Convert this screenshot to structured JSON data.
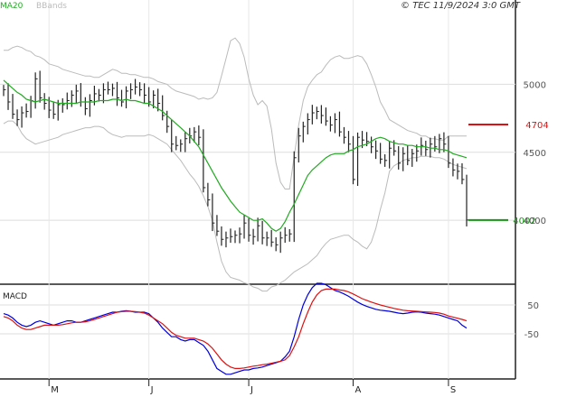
{
  "header": {
    "indicator_ma": "MA20",
    "indicator_bb": "BBands",
    "copyright": "© TEC 11/9/2024 3:0 GMT"
  },
  "macd_title": "MACD",
  "colors": {
    "price": "#222222",
    "ma": "#22aa22",
    "bbands": "#bbbbbb",
    "macd": "#0000dd",
    "signal": "#dd1111",
    "resistance": "#dd1111",
    "support": "#119911",
    "grid": "#dddddd"
  },
  "chart_data": [
    {
      "type": "bar",
      "subtype": "ohlc_price_chart",
      "y_ticks": [
        "5000",
        "4500",
        "4000"
      ],
      "y_tick_values": [
        5000,
        4500,
        4000
      ],
      "ylim": [
        3550,
        5500
      ],
      "x_ticks": [
        {
          "label": "M",
          "index": 10
        },
        {
          "label": "J",
          "index": 32
        },
        {
          "label": "J",
          "index": 54
        },
        {
          "label": "A",
          "index": 77
        },
        {
          "label": "S",
          "index": 98
        }
      ],
      "levels": [
        {
          "name": "resistance",
          "value": 4704,
          "label": "4704"
        },
        {
          "name": "support",
          "value": 4002,
          "label": "4002"
        }
      ],
      "close": [
        4960,
        4870,
        4780,
        4740,
        4790,
        4800,
        4880,
        5040,
        4900,
        4860,
        4810,
        4780,
        4850,
        4850,
        4880,
        4920,
        4950,
        4870,
        4820,
        4880,
        4930,
        4920,
        4960,
        4960,
        4970,
        4900,
        4870,
        4950,
        4960,
        4980,
        4960,
        4920,
        4870,
        4920,
        4860,
        4770,
        4690,
        4560,
        4550,
        4560,
        4600,
        4620,
        4650,
        4610,
        4240,
        4150,
        3980,
        3920,
        3860,
        3870,
        3880,
        3890,
        3900,
        3980,
        3890,
        3880,
        3960,
        3870,
        3870,
        3840,
        3820,
        3870,
        3890,
        3900,
        4460,
        4620,
        4690,
        4740,
        4790,
        4800,
        4770,
        4730,
        4700,
        4740,
        4650,
        4610,
        4560,
        4300,
        4610,
        4590,
        4580,
        4540,
        4510,
        4450,
        4440,
        4530,
        4510,
        4420,
        4490,
        4440,
        4490,
        4510,
        4550,
        4520,
        4560,
        4540,
        4600,
        4560,
        4420,
        4370,
        4360,
        4300,
        4002
      ],
      "ma20": [
        5030,
        5000,
        4970,
        4940,
        4920,
        4890,
        4880,
        4870,
        4880,
        4890,
        4880,
        4870,
        4860,
        4860,
        4860,
        4860,
        4860,
        4870,
        4870,
        4870,
        4870,
        4880,
        4880,
        4880,
        4890,
        4890,
        4880,
        4890,
        4880,
        4880,
        4870,
        4860,
        4860,
        4840,
        4820,
        4800,
        4770,
        4740,
        4710,
        4680,
        4650,
        4620,
        4580,
        4540,
        4480,
        4420,
        4360,
        4300,
        4240,
        4190,
        4140,
        4100,
        4060,
        4040,
        4020,
        4000,
        4000,
        4010,
        3980,
        3940,
        3920,
        3940,
        3990,
        4060,
        4120,
        4190,
        4260,
        4330,
        4370,
        4400,
        4430,
        4460,
        4480,
        4490,
        4490,
        4490,
        4510,
        4520,
        4540,
        4550,
        4560,
        4580,
        4600,
        4610,
        4600,
        4580,
        4570,
        4560,
        4560,
        4550,
        4550,
        4540,
        4540,
        4540,
        4530,
        4530,
        4520,
        4520,
        4510,
        4490,
        4480,
        4470,
        4460
      ],
      "bb_upper": [
        5250,
        5250,
        5270,
        5280,
        5270,
        5250,
        5240,
        5210,
        5200,
        5180,
        5150,
        5140,
        5130,
        5110,
        5100,
        5090,
        5080,
        5070,
        5060,
        5060,
        5050,
        5050,
        5070,
        5090,
        5110,
        5100,
        5080,
        5080,
        5070,
        5070,
        5060,
        5050,
        5050,
        5040,
        5020,
        5010,
        5000,
        4970,
        4950,
        4940,
        4930,
        4920,
        4910,
        4890,
        4900,
        4890,
        4900,
        4940,
        5060,
        5190,
        5320,
        5340,
        5300,
        5200,
        5040,
        4920,
        4850,
        4880,
        4840,
        4670,
        4420,
        4280,
        4230,
        4230,
        4470,
        4700,
        4880,
        4980,
        5030,
        5070,
        5090,
        5140,
        5180,
        5200,
        5210,
        5190,
        5190,
        5200,
        5210,
        5200,
        5150,
        5070,
        4980,
        4870,
        4810,
        4740,
        4720,
        4700,
        4680,
        4660,
        4650,
        4640,
        4620,
        4620,
        4600,
        4600,
        4590,
        4590,
        4620,
        4620,
        4620,
        4620,
        4620
      ],
      "bb_lower": [
        4710,
        4730,
        4730,
        4700,
        4640,
        4600,
        4580,
        4560,
        4570,
        4580,
        4590,
        4600,
        4610,
        4630,
        4640,
        4650,
        4660,
        4670,
        4680,
        4680,
        4690,
        4690,
        4680,
        4650,
        4630,
        4620,
        4610,
        4620,
        4620,
        4620,
        4620,
        4620,
        4630,
        4620,
        4600,
        4580,
        4560,
        4520,
        4480,
        4440,
        4390,
        4340,
        4300,
        4250,
        4180,
        4100,
        4000,
        3840,
        3700,
        3620,
        3580,
        3570,
        3560,
        3540,
        3530,
        3510,
        3500,
        3480,
        3480,
        3510,
        3520,
        3540,
        3560,
        3590,
        3620,
        3640,
        3660,
        3680,
        3710,
        3740,
        3790,
        3830,
        3860,
        3870,
        3880,
        3890,
        3890,
        3860,
        3840,
        3810,
        3790,
        3840,
        3940,
        4080,
        4200,
        4360,
        4400,
        4420,
        4440,
        4450,
        4460,
        4460,
        4470,
        4470,
        4470,
        4460,
        4460,
        4450,
        4430,
        4410,
        4400,
        4390,
        4380
      ]
    },
    {
      "type": "line",
      "subtype": "macd_panel",
      "title": "MACD",
      "y_ticks": [
        "50",
        "-50"
      ],
      "y_tick_values": [
        50,
        -50
      ],
      "ylim": [
        -200,
        100
      ],
      "series": [
        {
          "role": "macd",
          "values": [
            20,
            15,
            5,
            -10,
            -20,
            -25,
            -20,
            -10,
            -5,
            -10,
            -15,
            -20,
            -15,
            -10,
            -5,
            -5,
            -10,
            -10,
            -5,
            0,
            5,
            10,
            15,
            20,
            25,
            25,
            28,
            30,
            28,
            25,
            25,
            25,
            20,
            5,
            -10,
            -30,
            -45,
            -60,
            -60,
            -70,
            -75,
            -70,
            -70,
            -80,
            -90,
            -110,
            -140,
            -170,
            -180,
            -190,
            -190,
            -185,
            -180,
            -175,
            -175,
            -170,
            -168,
            -165,
            -160,
            -155,
            -150,
            -145,
            -130,
            -110,
            -60,
            0,
            50,
            85,
            110,
            125,
            125,
            120,
            110,
            100,
            95,
            88,
            80,
            70,
            60,
            52,
            45,
            40,
            35,
            32,
            30,
            28,
            25,
            22,
            20,
            22,
            25,
            26,
            25,
            22,
            20,
            18,
            15,
            10,
            5,
            0,
            -5,
            -20,
            -30
          ]
        },
        {
          "role": "signal",
          "values": [
            10,
            5,
            -5,
            -20,
            -30,
            -35,
            -35,
            -30,
            -25,
            -20,
            -20,
            -20,
            -20,
            -18,
            -15,
            -12,
            -10,
            -10,
            -8,
            -5,
            0,
            5,
            10,
            15,
            20,
            25,
            27,
            28,
            28,
            27,
            25,
            22,
            15,
            5,
            -5,
            -15,
            -30,
            -45,
            -55,
            -60,
            -65,
            -65,
            -65,
            -70,
            -75,
            -85,
            -100,
            -120,
            -140,
            -155,
            -165,
            -170,
            -170,
            -168,
            -165,
            -162,
            -160,
            -157,
            -155,
            -152,
            -148,
            -145,
            -140,
            -125,
            -95,
            -60,
            -15,
            25,
            60,
            85,
            100,
            105,
            105,
            105,
            102,
            100,
            95,
            88,
            80,
            72,
            66,
            60,
            55,
            50,
            46,
            42,
            38,
            35,
            32,
            30,
            29,
            28,
            27,
            26,
            25,
            24,
            22,
            18,
            12,
            8,
            4,
            0,
            -5
          ]
        }
      ]
    }
  ]
}
